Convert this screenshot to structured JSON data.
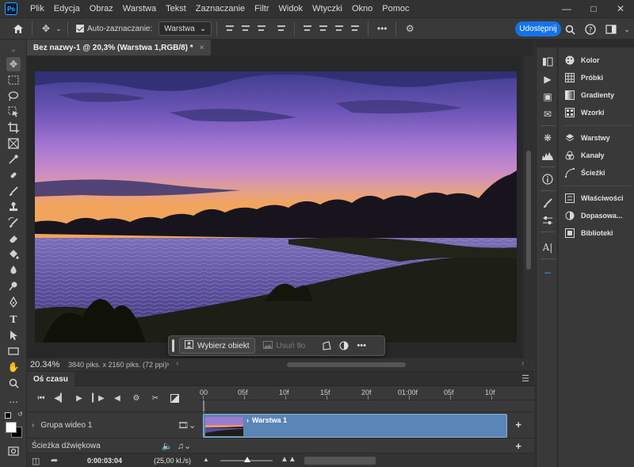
{
  "app": {
    "logo": "Ps",
    "menu": [
      "Plik",
      "Edycja",
      "Obraz",
      "Warstwa",
      "Tekst",
      "Zaznaczanie",
      "Filtr",
      "Widok",
      "Wtyczki",
      "Okno",
      "Pomoc"
    ]
  },
  "options_bar": {
    "auto_select_label": "Auto-zaznaczanie:",
    "layer_select_value": "Warstwa",
    "more_label": "•••",
    "share_label": "Udostępnij"
  },
  "document": {
    "tab_title": "Bez nazwy-1 @ 20,3% (Warstwa 1,RGB/8) *",
    "close_glyph": "×"
  },
  "status": {
    "zoom": "20.34%",
    "doc_info": "3840 piks. x 2160 piks. (72 ppi)"
  },
  "taskbar": {
    "select_subject": "Wybierz obiekt",
    "remove_bg": "Usuń tło",
    "more": "•••"
  },
  "timeline": {
    "tab": "Oś czasu",
    "ruler": [
      "00",
      "05f",
      "10f",
      "15f",
      "20f",
      "01:00f",
      "05f",
      "10f"
    ],
    "video_group": "Grupa wideo 1",
    "clip_name": "Warstwa 1",
    "audio_track": "Ścieżka dźwiękowa",
    "timecode": "0:00:03:04",
    "fps": "(25,00 kl./s)"
  },
  "panels": {
    "group1": [
      "Kolor",
      "Próbki",
      "Gradienty",
      "Wzorki"
    ],
    "group2": [
      "Warstwy",
      "Kanały",
      "Ścieżki"
    ],
    "group3": [
      "Właściwości",
      "Dopasowa...",
      "Biblioteki"
    ]
  },
  "colors": {
    "accent": "#1473e6",
    "clip": "#5b84b7",
    "background": "#323232"
  }
}
